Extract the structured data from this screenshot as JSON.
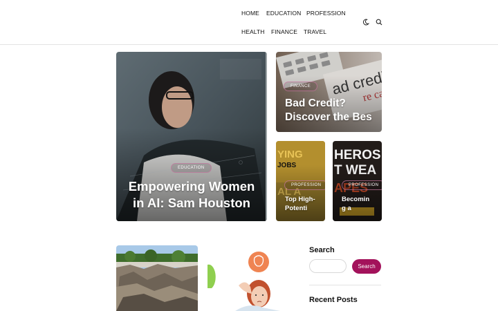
{
  "nav": {
    "items": [
      "HOME",
      "EDUCATION",
      "PROFESSION",
      "HEALTH",
      "FINANCE",
      "TRAVEL"
    ]
  },
  "header_icons": {
    "theme": "moon-icon",
    "search": "search-icon"
  },
  "featured": {
    "main": {
      "category": "EDUCATION",
      "title_line1": "Empowering Women",
      "title_line2": "in AI: Sam Houston"
    },
    "top_right": {
      "category": "FINANCE",
      "title_line1": "Bad Credit?",
      "title_line2": "Discover the Bes"
    },
    "bottom_left": {
      "category": "PROFESSION",
      "title_line1": "Top High-",
      "title_line2": "Potenti"
    },
    "bottom_right": {
      "category": "PROFESSION",
      "title_line1": "Becomin",
      "title_line2": "g a"
    }
  },
  "sidebar": {
    "search_heading": "Search",
    "search_placeholder": "",
    "search_button": "Search",
    "recent_heading": "Recent Posts"
  },
  "colors": {
    "accent": "#a3125b",
    "pill_border": "#c878a0"
  }
}
